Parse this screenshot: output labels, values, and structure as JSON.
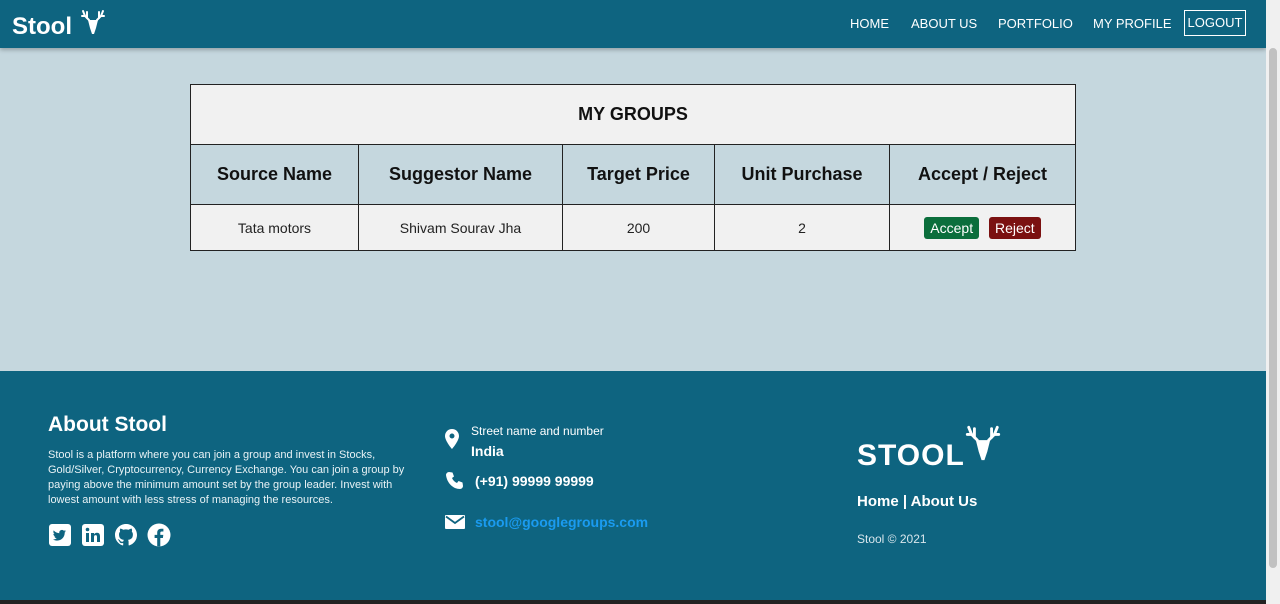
{
  "nav": {
    "brand": "Stool",
    "links": [
      "HOME",
      "ABOUT US",
      "PORTFOLIO",
      "MY PROFILE"
    ],
    "logout": "LOGOUT"
  },
  "table": {
    "title": "MY GROUPS",
    "headers": [
      "Source Name",
      "Suggestor Name",
      "Target Price",
      "Unit Purchase",
      "Accept / Reject"
    ],
    "rows": [
      {
        "source": "Tata motors",
        "suggestor": "Shivam Sourav Jha",
        "target_price": "200",
        "units": "2",
        "accept": "Accept",
        "reject": "Reject"
      }
    ]
  },
  "footer": {
    "about_title": "About Stool",
    "about_text": "Stool is a platform where you can join a group and invest in Stocks, Gold/Silver, Cryptocurrency, Currency Exchange. You can join a group by paying above the minimum amount set by the group leader. Invest with lowest amount with less stress of managing the resources.",
    "socials": [
      "twitter-icon",
      "linkedin-icon",
      "github-icon",
      "facebook-icon"
    ],
    "street": "Street name and number",
    "country": "India",
    "phone": "(+91) 99999 99999",
    "email": "stool@googlegroups.com",
    "brand": "STOOL",
    "home_link": "Home",
    "separator": " | ",
    "about_link": "About Us",
    "copyright": "Stool © 2021"
  },
  "colors": {
    "primary": "#0e6480",
    "background": "#c5d7de",
    "accept": "#0b6e3c",
    "reject": "#7b1111",
    "email": "#1a9bf0"
  }
}
